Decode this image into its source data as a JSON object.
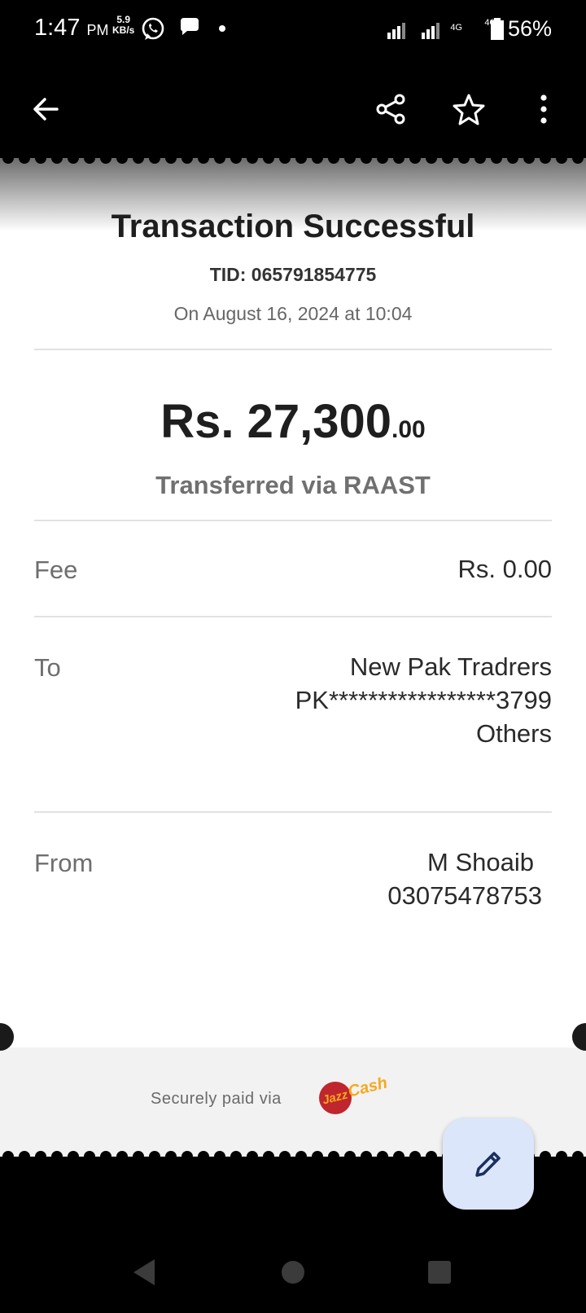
{
  "status_bar": {
    "time": "1:47",
    "ampm": "PM",
    "speed_value": "5.9",
    "speed_unit": "KB/s",
    "network": "4G",
    "battery": "56%"
  },
  "receipt": {
    "title": "Transaction Successful",
    "tid": "TID: 065791854775",
    "date": "On August 16, 2024 at 10:04",
    "amount_main": "Rs. 27,300",
    "amount_decimal": ".00",
    "method": "Transferred via RAAST",
    "fee": {
      "label": "Fee",
      "value": "Rs. 0.00"
    },
    "to": {
      "label": "To",
      "name": "New Pak Tradrers",
      "account": "PK*****************3799",
      "bank": "Others"
    },
    "from": {
      "label": "From",
      "name": "M Shoaib",
      "number": "03075478753"
    },
    "footer_text": "Securely paid via",
    "brand": "JazzCash"
  },
  "colors": {
    "fab_bg": "#dce6fb",
    "fab_icon": "#1b2f5c",
    "brand_red": "#c0262d",
    "brand_yellow": "#f6a81e"
  }
}
